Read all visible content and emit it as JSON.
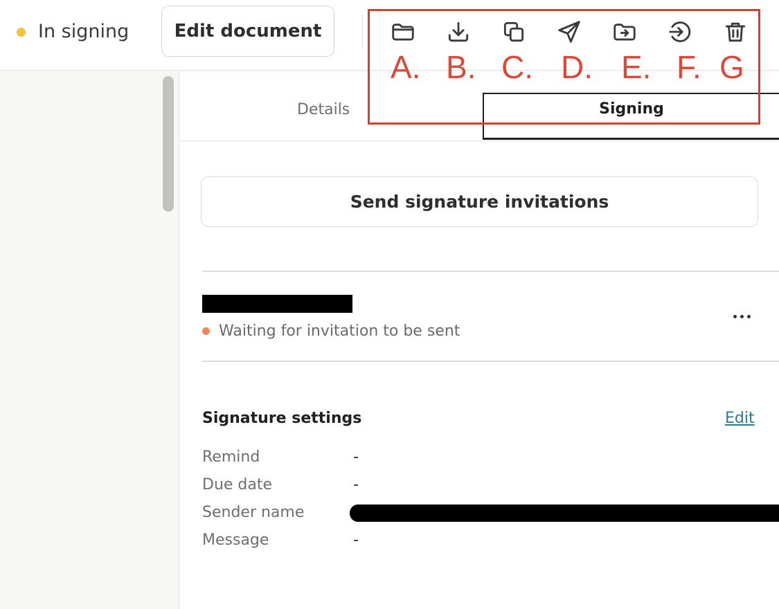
{
  "header": {
    "status_label": "In signing",
    "status_color": "#f2c23d",
    "edit_document_label": "Edit document"
  },
  "toolbar": {
    "icons": [
      {
        "name": "folder-icon",
        "letter": "A."
      },
      {
        "name": "download-icon",
        "letter": "B."
      },
      {
        "name": "copy-icon",
        "letter": "C."
      },
      {
        "name": "send-icon",
        "letter": "D."
      },
      {
        "name": "move-to-folder-icon",
        "letter": "E."
      },
      {
        "name": "arrow-right-circle-icon",
        "letter": "F."
      },
      {
        "name": "trash-icon",
        "letter": "G"
      }
    ],
    "annotation_color": "#d23f2f"
  },
  "tabs": [
    {
      "label": "Details",
      "active": false
    },
    {
      "label": "Signing",
      "active": true
    }
  ],
  "main": {
    "send_button_label": "Send signature invitations",
    "signer": {
      "status_text": "Waiting for invitation to be sent",
      "status_color": "#ec8a5a"
    },
    "settings": {
      "title": "Signature settings",
      "edit_label": "Edit",
      "rows": [
        {
          "label": "Remind",
          "value": "-"
        },
        {
          "label": "Due date",
          "value": "-"
        },
        {
          "label": "Sender name",
          "value": ""
        },
        {
          "label": "Message",
          "value": "-"
        }
      ]
    }
  }
}
